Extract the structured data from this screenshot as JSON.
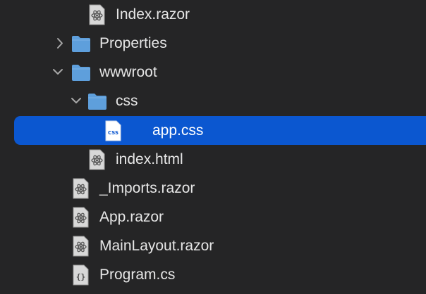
{
  "file_tree": {
    "items": [
      {
        "label": "Index.razor",
        "type": "razor-file",
        "depth": 3
      },
      {
        "label": "Properties",
        "type": "folder",
        "depth": 2,
        "expanded": false
      },
      {
        "label": "wwwroot",
        "type": "folder",
        "depth": 2,
        "expanded": true
      },
      {
        "label": "css",
        "type": "folder",
        "depth": 3,
        "expanded": true
      },
      {
        "label": "app.css",
        "type": "css-file",
        "depth": 4,
        "selected": true,
        "badge": "CSS"
      },
      {
        "label": "index.html",
        "type": "html-file",
        "depth": 3
      },
      {
        "label": "_Imports.razor",
        "type": "razor-file",
        "depth": 2
      },
      {
        "label": "App.razor",
        "type": "razor-file",
        "depth": 2
      },
      {
        "label": "MainLayout.razor",
        "type": "razor-file",
        "depth": 2
      },
      {
        "label": "Program.cs",
        "type": "cs-file",
        "depth": 2,
        "badge": "{}"
      }
    ]
  },
  "colors": {
    "background": "#252526",
    "selection": "#0b57d0",
    "folder": "#5e9fdc",
    "text": "#e6e6e6",
    "chevron": "#a8a8a8"
  }
}
